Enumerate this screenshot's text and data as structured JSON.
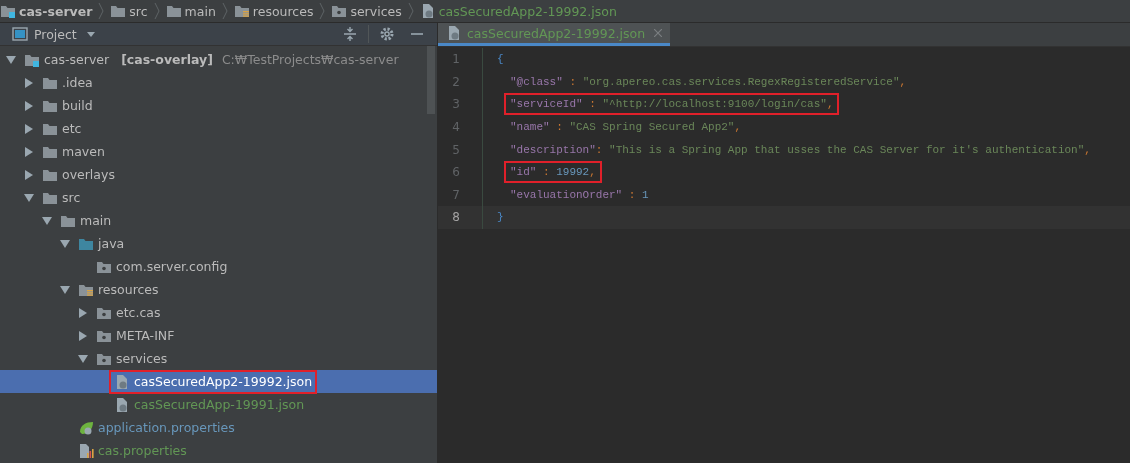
{
  "breadcrumbs": [
    {
      "label": "cas-server",
      "kind": "module",
      "bold": true
    },
    {
      "label": "src",
      "kind": "folder",
      "bold": false
    },
    {
      "label": "main",
      "kind": "folder",
      "bold": false
    },
    {
      "label": "resources",
      "kind": "resources",
      "bold": false
    },
    {
      "label": "services",
      "kind": "package",
      "bold": false
    },
    {
      "label": "casSecuredApp2-19992.json",
      "kind": "json",
      "bold": false,
      "color": "#629755"
    }
  ],
  "project_panel": {
    "title": "Project",
    "tree": [
      {
        "label": "cas-server",
        "module": "[cas-overlay]",
        "path": "C:₩TestProjects₩cas-server",
        "kind": "module",
        "expanded": true,
        "selected": false,
        "boxed": false,
        "children": [
          {
            "label": ".idea",
            "kind": "folder",
            "expanded": false,
            "selected": false,
            "boxed": false
          },
          {
            "label": "build",
            "kind": "folder",
            "expanded": false,
            "selected": false,
            "boxed": false
          },
          {
            "label": "etc",
            "kind": "folder",
            "expanded": false,
            "selected": false,
            "boxed": false
          },
          {
            "label": "maven",
            "kind": "folder",
            "expanded": false,
            "selected": false,
            "boxed": false
          },
          {
            "label": "overlays",
            "kind": "folder",
            "expanded": false,
            "selected": false,
            "boxed": false
          },
          {
            "label": "src",
            "kind": "folder",
            "expanded": true,
            "selected": false,
            "boxed": false,
            "children": [
              {
                "label": "main",
                "kind": "folder",
                "expanded": true,
                "selected": false,
                "boxed": false,
                "children": [
                  {
                    "label": "java",
                    "kind": "source",
                    "expanded": true,
                    "selected": false,
                    "boxed": false,
                    "children": [
                      {
                        "label": "com.server.config",
                        "kind": "package",
                        "selected": false,
                        "boxed": false
                      }
                    ]
                  },
                  {
                    "label": "resources",
                    "kind": "resources",
                    "expanded": true,
                    "selected": false,
                    "boxed": false,
                    "children": [
                      {
                        "label": "etc.cas",
                        "kind": "package",
                        "expanded": false,
                        "selected": false,
                        "boxed": false
                      },
                      {
                        "label": "META-INF",
                        "kind": "package",
                        "expanded": false,
                        "selected": false,
                        "boxed": false
                      },
                      {
                        "label": "services",
                        "kind": "package",
                        "expanded": true,
                        "selected": false,
                        "boxed": false,
                        "children": [
                          {
                            "label": "casSecuredApp2-19992.json",
                            "kind": "json",
                            "selected": true,
                            "boxed": true
                          },
                          {
                            "label": "casSecuredApp-19991.json",
                            "kind": "json",
                            "selected": false,
                            "boxed": false,
                            "color": "#629755"
                          }
                        ]
                      }
                    ]
                  },
                  {
                    "label": "application.properties",
                    "kind": "spring",
                    "selected": false,
                    "boxed": false,
                    "color": "#6897bb"
                  },
                  {
                    "label": "cas.properties",
                    "kind": "properties",
                    "selected": false,
                    "boxed": false,
                    "color": "#629755"
                  }
                ]
              }
            ]
          }
        ]
      }
    ]
  },
  "editor": {
    "tabs": [
      {
        "label": "casSecuredApp2-19992.json",
        "selected": true,
        "color": "#629755"
      }
    ],
    "lines": [
      {
        "number": "1",
        "kind": "brace",
        "current": false,
        "boxed": false,
        "tokens": [
          {
            "kind": "brace",
            "text": "{"
          }
        ]
      },
      {
        "number": "2",
        "kind": "member",
        "current": false,
        "boxed": false,
        "tokens": [
          {
            "kind": "key",
            "text": "\"@class\""
          },
          {
            "kind": "punct",
            "text": " : "
          },
          {
            "kind": "string",
            "text": "\"org.apereo.cas.services.RegexRegisteredService\""
          },
          {
            "kind": "punct",
            "text": ","
          }
        ]
      },
      {
        "number": "3",
        "kind": "member",
        "current": false,
        "boxed": true,
        "tokens": [
          {
            "kind": "key",
            "text": "\"serviceId\""
          },
          {
            "kind": "punct",
            "text": " : "
          },
          {
            "kind": "string",
            "text": "\"^http://localhost:9100/login/cas\""
          },
          {
            "kind": "punct",
            "text": ","
          }
        ]
      },
      {
        "number": "4",
        "kind": "member",
        "current": false,
        "boxed": false,
        "tokens": [
          {
            "kind": "key",
            "text": "\"name\""
          },
          {
            "kind": "punct",
            "text": " : "
          },
          {
            "kind": "string",
            "text": "\"CAS Spring Secured App2\""
          },
          {
            "kind": "punct",
            "text": ","
          }
        ]
      },
      {
        "number": "5",
        "kind": "member",
        "current": false,
        "boxed": false,
        "tokens": [
          {
            "kind": "key",
            "text": "\"description\""
          },
          {
            "kind": "punct",
            "text": ": "
          },
          {
            "kind": "string",
            "text": "\"This is a Spring App that usses the CAS Server for it's authentication\""
          },
          {
            "kind": "punct",
            "text": ","
          }
        ]
      },
      {
        "number": "6",
        "kind": "member",
        "current": false,
        "boxed": true,
        "tokens": [
          {
            "kind": "key",
            "text": "\"id\""
          },
          {
            "kind": "punct",
            "text": " : "
          },
          {
            "kind": "number",
            "text": "19992"
          },
          {
            "kind": "punct",
            "text": ","
          }
        ]
      },
      {
        "number": "7",
        "kind": "member",
        "current": false,
        "boxed": false,
        "tokens": [
          {
            "kind": "key",
            "text": "\"evaluationOrder\""
          },
          {
            "kind": "punct",
            "text": " : "
          },
          {
            "kind": "number",
            "text": "1"
          }
        ]
      },
      {
        "number": "8",
        "kind": "brace",
        "current": true,
        "boxed": false,
        "tokens": [
          {
            "kind": "brace",
            "text": "}"
          }
        ]
      }
    ]
  }
}
